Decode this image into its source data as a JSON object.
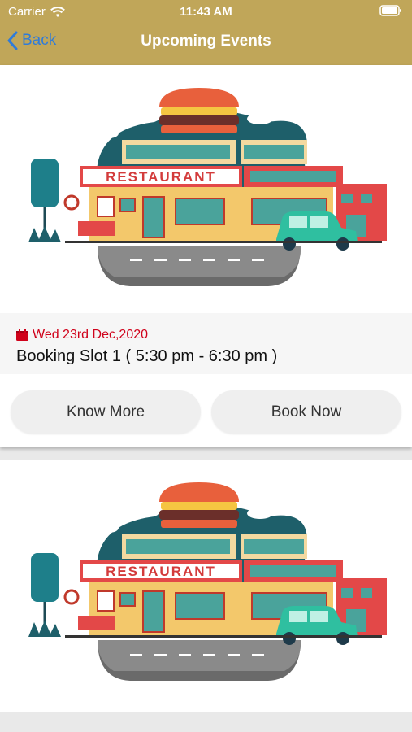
{
  "status": {
    "carrier": "Carrier",
    "time": "11:43 AM"
  },
  "nav": {
    "back_label": "Back",
    "title": "Upcoming Events"
  },
  "events": [
    {
      "image_sign": "RESTAURANT",
      "date": "Wed 23rd Dec,2020",
      "slot": "Booking Slot 1 ( 5:30 pm - 6:30 pm )",
      "know_more_label": "Know More",
      "book_now_label": "Book Now"
    },
    {
      "image_sign": "RESTAURANT"
    }
  ],
  "colors": {
    "header": "#c0a659",
    "back": "#2f7bd9",
    "date": "#d0021b"
  }
}
